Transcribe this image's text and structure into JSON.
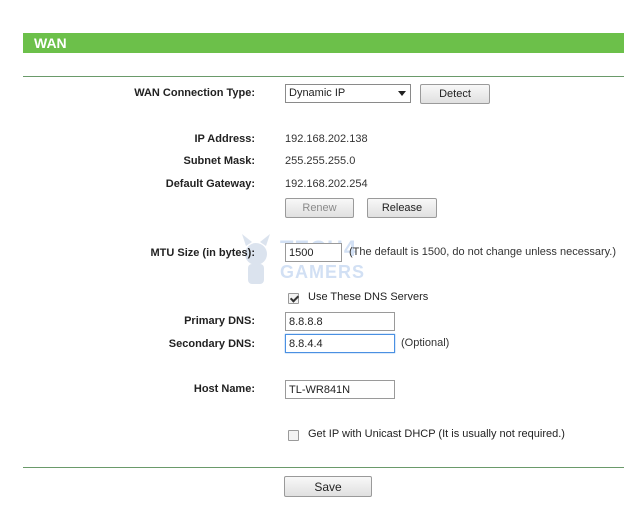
{
  "header": {
    "title": "WAN"
  },
  "connection": {
    "label": "WAN Connection Type:",
    "selected": "Dynamic IP",
    "detect_label": "Detect"
  },
  "status": {
    "ip_label": "IP Address:",
    "ip_value": "192.168.202.138",
    "mask_label": "Subnet Mask:",
    "mask_value": "255.255.255.0",
    "gateway_label": "Default Gateway:",
    "gateway_value": "192.168.202.254",
    "renew_label": "Renew",
    "release_label": "Release"
  },
  "mtu": {
    "label": "MTU Size (in bytes):",
    "value": "1500",
    "hint": "(The default is 1500, do not change unless necessary.)"
  },
  "dns": {
    "use_label": "Use These DNS Servers",
    "use_checked": true,
    "primary_label": "Primary DNS:",
    "primary_value": "8.8.8.8",
    "secondary_label": "Secondary DNS:",
    "secondary_value": "8.8.4.4",
    "optional_hint": "(Optional)"
  },
  "host": {
    "label": "Host Name:",
    "value": "TL-WR841N"
  },
  "unicast": {
    "label": "Get IP with Unicast DHCP (It is usually not required.)",
    "checked": false
  },
  "footer": {
    "save_label": "Save"
  },
  "watermark": {
    "line1": "TECH4",
    "line2": "GAMERS"
  },
  "colors": {
    "header_green": "#6cc04a",
    "focus_blue": "#4a90e2"
  }
}
